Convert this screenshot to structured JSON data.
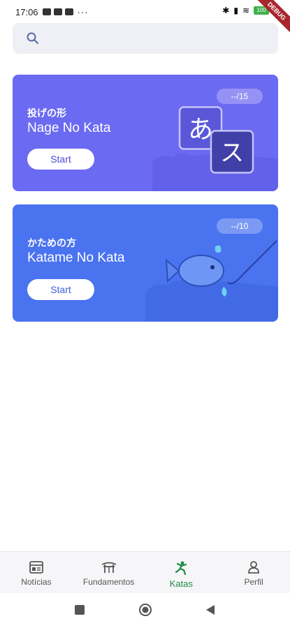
{
  "status_bar": {
    "time": "17:06",
    "dots": "···",
    "battery": "100",
    "debug": "DEBUG"
  },
  "search": {
    "placeholder": ""
  },
  "cards": [
    {
      "count": "--/15",
      "title_jp": "投げの形",
      "title_en": "Nage No Kata",
      "start_label": "Start",
      "illustration": "language-kana-icon",
      "glyph_a": "あ",
      "glyph_b": "ス"
    },
    {
      "count": "--/10",
      "title_jp": "かための方",
      "title_en": "Katame No Kata",
      "start_label": "Start",
      "illustration": "fishing-icon"
    }
  ],
  "bottom_nav": [
    {
      "label": "Notícias",
      "icon": "newspaper-icon",
      "active": false
    },
    {
      "label": "Fundamentos",
      "icon": "temple-icon",
      "active": false
    },
    {
      "label": "Katas",
      "icon": "karate-icon",
      "active": true
    },
    {
      "label": "Perfil",
      "icon": "person-icon",
      "active": false
    }
  ],
  "colors": {
    "card1": "#6b6af2",
    "card2": "#4a73f0",
    "active_nav": "#1e8a47"
  }
}
